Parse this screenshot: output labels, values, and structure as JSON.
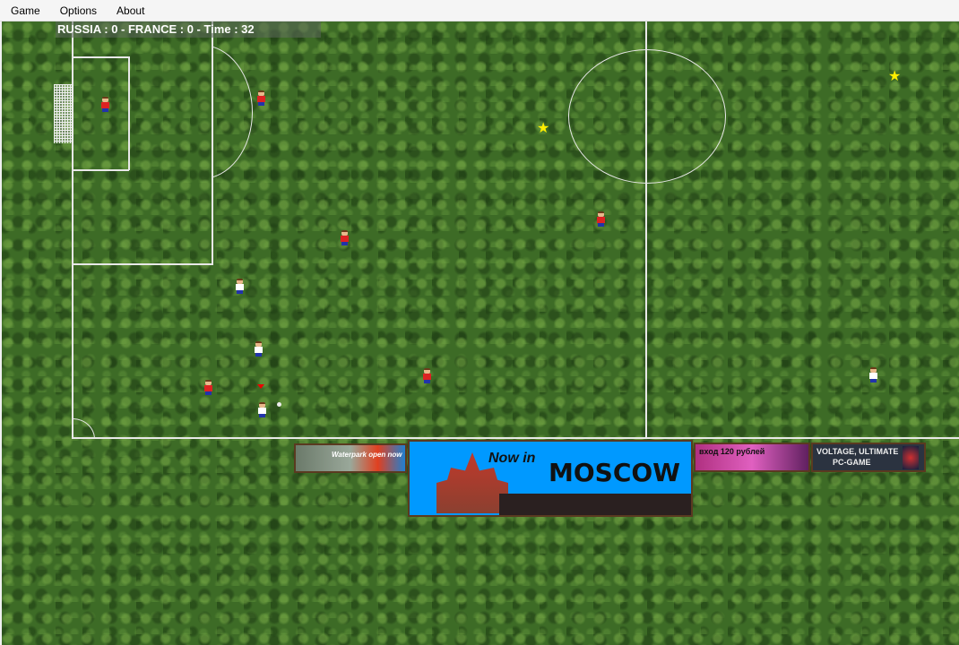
{
  "menu": {
    "items": [
      {
        "label": "Game"
      },
      {
        "label": "Options"
      },
      {
        "label": "About"
      }
    ]
  },
  "scoreboard": {
    "text": "RUSSIA : 0 - FRANCE : 0 - Time : 32",
    "team1": "RUSSIA",
    "score1": 0,
    "team2": "FRANCE",
    "score2": 0,
    "time": 32
  },
  "ads": [
    {
      "name": "waterpark",
      "text": "Waterpark open now"
    },
    {
      "name": "moscow",
      "text_small": "Now in",
      "text_big": "MOSCOW",
      "bg": "#0099ff"
    },
    {
      "name": "concert",
      "text": "вход 120 рублей"
    },
    {
      "name": "voltage",
      "line1": "VOLTAGE, ULTIMATE",
      "line2": "PC-GAME"
    }
  ],
  "colors": {
    "grass": "#3d6b26",
    "lines": "#e8e8e8",
    "star": "#ffee00",
    "team_russia": "#dd2222"
  }
}
